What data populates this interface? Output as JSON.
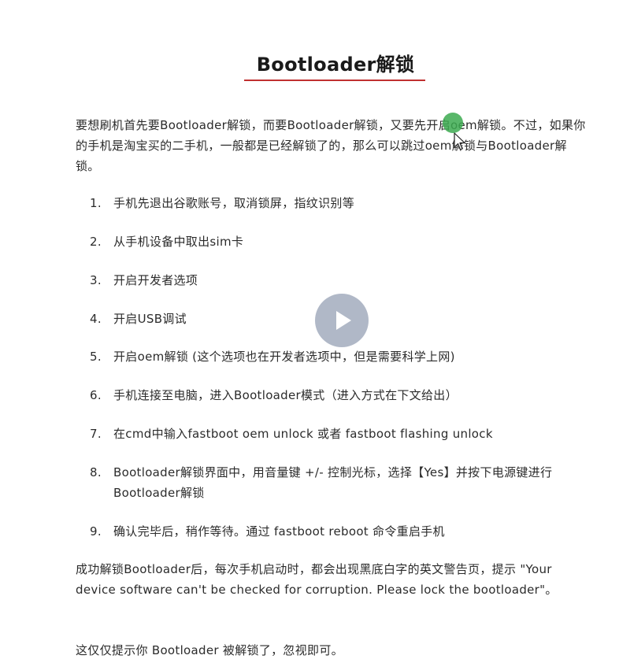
{
  "title": "Bootloader解锁",
  "intro": "要想刷机首先要Bootloader解锁，而要Bootloader解锁，又要先开启oem解锁。不过，如果你的手机是淘宝买的二手机，一般都是已经解锁了的，那么可以跳过oem解锁与Bootloader解锁。",
  "steps": [
    {
      "num": "1.",
      "text": "手机先退出谷歌账号，取消锁屏，指纹识别等"
    },
    {
      "num": "2.",
      "text": "从手机设备中取出sim卡"
    },
    {
      "num": "3.",
      "text": "开启开发者选项"
    },
    {
      "num": "4.",
      "text": "开启USB调试"
    },
    {
      "num": "5.",
      "text": "开启oem解锁 (这个选项也在开发者选项中，但是需要科学上网)"
    },
    {
      "num": "6.",
      "text": "手机连接至电脑，进入Bootloader模式（进入方式在下文给出）"
    },
    {
      "num": "7.",
      "text": "在cmd中输入fastboot oem unlock 或者 fastboot flashing unlock"
    },
    {
      "num": "8.",
      "text": "Bootloader解锁界面中，用音量键 +/- 控制光标，选择【Yes】并按下电源键进行 Bootloader解锁"
    },
    {
      "num": "9.",
      "text": "确认完毕后，稍作等待。通过 fastboot reboot 命令重启手机"
    }
  ],
  "outro1": "成功解锁Bootloader后，每次手机启动时，都会出现黑底白字的英文警告页，提示 \"Your device software can't be checked for corruption. Please lock the bootloader\"。",
  "outro2": "这仅仅提示你 Bootloader 被解锁了，忽视即可。",
  "colors": {
    "accent_underline": "#c03030",
    "cursor_highlight": "#3caa50",
    "play_button": "#96a0b4"
  },
  "icons": {
    "play": "play-icon",
    "cursor": "mouse-pointer-icon"
  }
}
